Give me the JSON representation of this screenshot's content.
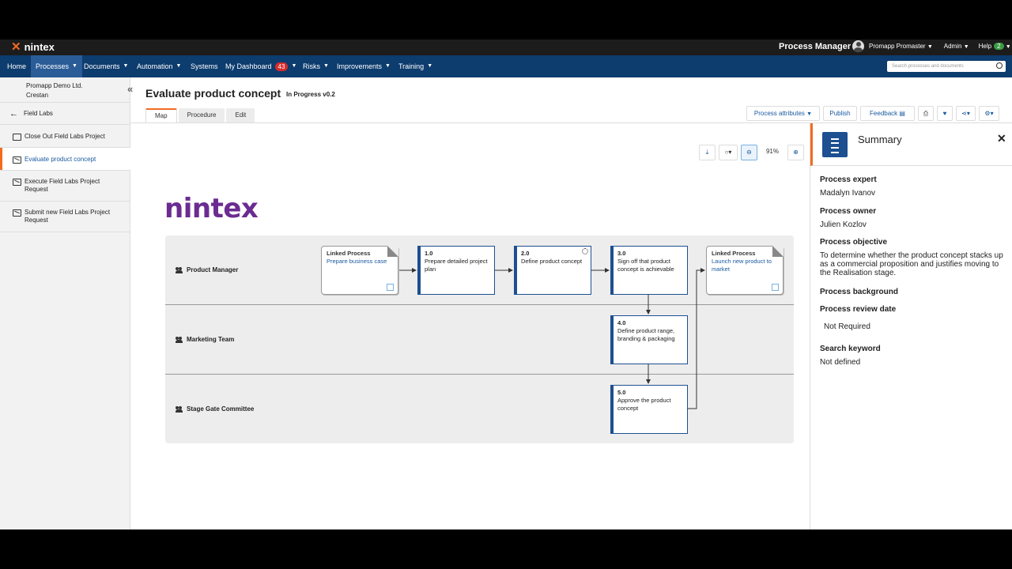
{
  "topbar": {
    "brand": "nintex",
    "app_title": "Process Manager",
    "user_name": "Promapp Promaster",
    "admin_label": "Admin",
    "help_label": "Help",
    "help_count": "2"
  },
  "nav": {
    "home": "Home",
    "processes": "Processes",
    "documents": "Documents",
    "automation": "Automation",
    "systems": "Systems",
    "dashboard": "My Dashboard",
    "dashboard_count": "43",
    "risks": "Risks",
    "improvements": "Improvements",
    "training": "Training",
    "search_placeholder": "Search processes and documents"
  },
  "sidebar": {
    "org_line1": "Promapp Demo Ltd.",
    "org_line2": "Crestan",
    "back_label": "Field Labs",
    "items": [
      {
        "label": "Close Out Field Labs Project"
      },
      {
        "label": "Evaluate product concept"
      },
      {
        "label": "Execute Field Labs Project Request"
      },
      {
        "label": "Submit new Field Labs Project Request"
      }
    ]
  },
  "page": {
    "title": "Evaluate product concept",
    "status": "In Progress v0.2",
    "tabs": [
      "Map",
      "Procedure",
      "Edit"
    ],
    "actions": {
      "attributes": "Process attributes",
      "publish": "Publish",
      "feedback": "Feedback"
    },
    "zoom_level": "91%"
  },
  "map": {
    "logo_text": "nintex",
    "lanes": [
      "Product Manager",
      "Marketing Team",
      "Stage Gate Committee"
    ],
    "linked_start": {
      "title": "Linked Process",
      "name": "Prepare business case"
    },
    "linked_end": {
      "title": "Linked Process",
      "name": "Launch new product to market"
    },
    "steps": [
      {
        "num": "1.0",
        "text": "Prepare detailed project plan"
      },
      {
        "num": "2.0",
        "text": "Define product concept"
      },
      {
        "num": "3.0",
        "text": "Sign off that product concept is achievable"
      },
      {
        "num": "4.0",
        "text": "Define product range, branding & packaging"
      },
      {
        "num": "5.0",
        "text": "Approve the product concept"
      }
    ]
  },
  "summary": {
    "title": "Summary",
    "expert_label": "Process expert",
    "expert": "Madalyn Ivanov",
    "owner_label": "Process owner",
    "owner": "Julien Kozlov",
    "objective_label": "Process objective",
    "objective": "To determine whether the product concept stacks up as a commercial proposition and justifies moving to the Realisation stage.",
    "background_label": "Process background",
    "review_label": "Process review date",
    "review": "Not Required",
    "keyword_label": "Search keyword",
    "keyword": "Not defined"
  }
}
